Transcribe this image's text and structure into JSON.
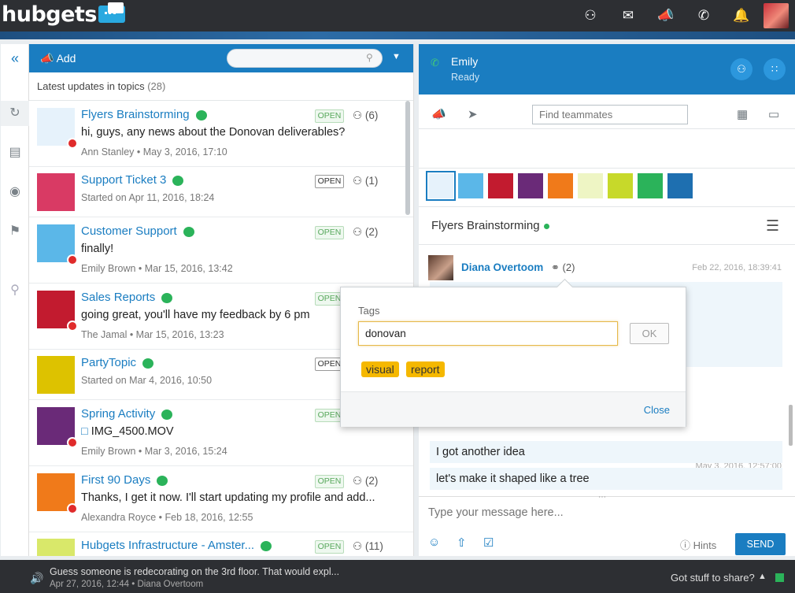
{
  "app": {
    "logo_text": "hubgets"
  },
  "topbar": {
    "icons": [
      "people-icon",
      "chat-icon",
      "megaphone-icon",
      "call-icon",
      "bell-icon"
    ]
  },
  "leftnav": {
    "icons": [
      "collapse-icon",
      "sync-icon",
      "news-icon",
      "eye-icon",
      "flag-icon",
      "search-icon"
    ]
  },
  "topics_panel": {
    "add_label": "Add",
    "search_placeholder": "",
    "latest_label": "Latest updates in topics",
    "latest_count": "(28)",
    "rows": [
      {
        "title": "Flyers Brainstorming",
        "message": "hi, guys, any news about the Donovan deliverables?",
        "meta": "Ann Stanley • May 3, 2016, 17:10",
        "badge": "OPEN",
        "badge_style": "green",
        "members": "(6)",
        "blocked": true,
        "thumb_color": "#e6f2fb"
      },
      {
        "title": "Support Ticket 3",
        "message": "",
        "meta": "Started on Apr 11, 2016, 18:24",
        "badge": "OPEN",
        "badge_style": "white",
        "members": "(1)",
        "blocked": false,
        "thumb_color": "#d93a64"
      },
      {
        "title": "Customer Support",
        "message": "finally!",
        "meta": "Emily Brown • Mar 15, 2016, 13:42",
        "badge": "OPEN",
        "badge_style": "green",
        "members": "(2)",
        "blocked": true,
        "thumb_color": "#5bb7e8"
      },
      {
        "title": "Sales Reports",
        "message": "going great, you'll have my feedback by 6 pm",
        "meta": "The Jamal • Mar 15, 2016, 13:23",
        "badge": "OPEN",
        "badge_style": "green",
        "members": "",
        "blocked": true,
        "thumb_color": "#c21b2f"
      },
      {
        "title": "PartyTopic",
        "message": "",
        "meta": "Started on Mar 4, 2016, 10:50",
        "badge": "OPEN",
        "badge_style": "white",
        "members": "",
        "blocked": false,
        "thumb_color": "#ddc200"
      },
      {
        "title": "Spring Activity",
        "message": "IMG_4500.MOV",
        "meta": "Emily Brown • Mar 3, 2016, 15:24",
        "badge": "OPEN",
        "badge_style": "green",
        "members": "",
        "blocked": true,
        "thumb_color": "#6a2a78"
      },
      {
        "title": "First 90 Days",
        "message": "Thanks, I get it now. I'll start updating my profile and add...",
        "meta": "Alexandra Royce • Feb 18, 2016, 12:55",
        "badge": "OPEN",
        "badge_style": "green",
        "members": "(2)",
        "blocked": true,
        "thumb_color": "#f07a1a"
      },
      {
        "title": "Hubgets Infrastructure - Amster...",
        "message": "",
        "meta": "",
        "badge": "OPEN",
        "badge_style": "green",
        "members": "(11)",
        "blocked": false,
        "thumb_color": "#d9e86a"
      }
    ]
  },
  "chat": {
    "contact_name": "Emily",
    "contact_status": "Ready",
    "find_placeholder": "Find teammates",
    "strip_colors": [
      "#e6f2fb",
      "#5bb7e8",
      "#c21b2f",
      "#6a2a78",
      "#f07a1a",
      "#eef5c4",
      "#c7d92a",
      "#2bb35a",
      "#1e6fb0"
    ],
    "topic_title": "Flyers Brainstorming",
    "message_author": "Diana Overtoom",
    "message_tags": "(2)",
    "message_time": "Feb 22, 2016, 18:39:41",
    "second_time": "May 3, 2016, 12:57:00",
    "lines": [
      "I got another idea",
      "let's make it shaped like a tree"
    ],
    "composer_placeholder": "Type your message here...",
    "hints_label": "Hints",
    "send_label": "SEND"
  },
  "tags_popover": {
    "label": "Tags",
    "input_value": "donovan",
    "ok_label": "OK",
    "chips": [
      "visual",
      "report"
    ],
    "close_label": "Close"
  },
  "statusbar": {
    "line1": "Guess someone is redecorating on the 3rd floor. That would expl...",
    "line2": "Apr 27, 2016, 12:44  •  Diana Overtoom",
    "share_label": "Got stuff to share?"
  }
}
